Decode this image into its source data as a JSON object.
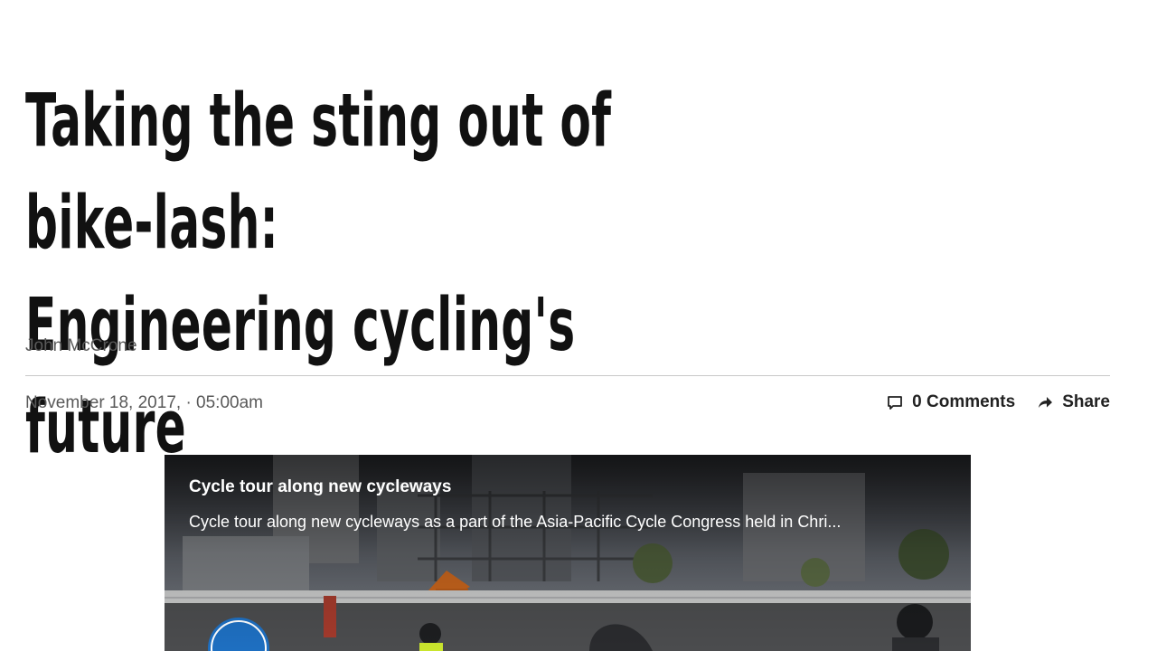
{
  "article": {
    "headline_line1": "Taking the sting out of bike-lash:",
    "headline_line2": "Engineering cycling's future",
    "author": "John McCrone",
    "dateline": "November 18, 2017, · 05:00am"
  },
  "actions": {
    "comments_icon": "speech-bubble-icon",
    "comments_label": "0 Comments",
    "share_icon": "share-arrow-icon",
    "share_label": "Share"
  },
  "media": {
    "title": "Cycle tour along new cycleways",
    "caption": "Cycle tour along new cycleways as a part of the Asia-Pacific Cycle Congress held in Chri..."
  }
}
